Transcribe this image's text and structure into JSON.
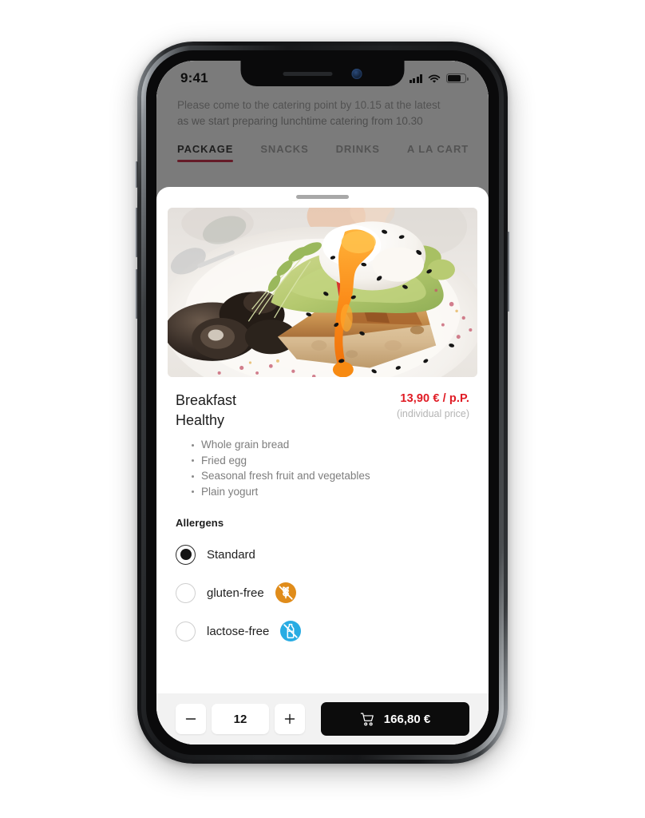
{
  "status_bar": {
    "time": "9:41",
    "signal_icon": "cellular-bars-icon",
    "wifi_icon": "wifi-icon",
    "battery_icon": "battery-icon"
  },
  "header_note": {
    "line1": "Please come to the catering point by 10.15 at the latest",
    "line2": "as we start preparing lunchtime catering from 10.30"
  },
  "tabs": [
    {
      "label": "PACKAGE",
      "active": true
    },
    {
      "label": "SNACKS",
      "active": false
    },
    {
      "label": "DRINKS",
      "active": false
    },
    {
      "label": "A LA CART",
      "active": false
    }
  ],
  "sheet": {
    "grabber": "drag-handle",
    "hero_image_alt": "avocado toast with poached egg and mushrooms on a white plate",
    "product": {
      "name_line1": "Breakfast",
      "name_line2": "Healthy",
      "price": "13,90 € / p.P.",
      "price_note": "(individual price)",
      "ingredients": [
        "Whole grain bread",
        "Fried egg",
        "Seasonal fresh fruit and vegetables",
        "Plain yogurt"
      ]
    },
    "allergens": {
      "heading": "Allergens",
      "options": [
        {
          "label": "Standard",
          "selected": true,
          "badge_icon": null,
          "badge_color": null
        },
        {
          "label": "gluten-free",
          "selected": false,
          "badge_icon": "no-gluten-wheat-icon",
          "badge_color": "#e08c1a"
        },
        {
          "label": "lactose-free",
          "selected": false,
          "badge_icon": "no-lactose-bottle-icon",
          "badge_color": "#29ace3"
        }
      ]
    }
  },
  "action_bar": {
    "decrement_label": "−",
    "quantity": "12",
    "increment_label": "+",
    "cart_icon": "shopping-cart-icon",
    "cart_total": "166,80 €"
  },
  "colors": {
    "accent_red": "#c8102e",
    "price_red": "#e01b24",
    "cart_black": "#0c0c0c",
    "bar_gray": "#f2f2f2"
  }
}
